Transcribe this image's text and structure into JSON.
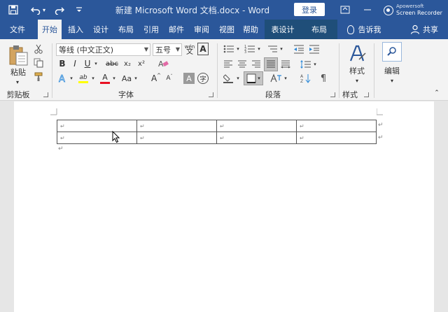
{
  "titlebar": {
    "doc_title": "新建 Microsoft Word 文档.docx  -  Word",
    "login_label": "登录",
    "recorder_line1": "Apowersoft",
    "recorder_line2": "Screen Recorder"
  },
  "tabs": {
    "file": "文件",
    "home": "开始",
    "insert": "插入",
    "design": "设计",
    "layout": "布局",
    "references": "引用",
    "mailings": "邮件",
    "review": "审阅",
    "view": "视图",
    "help": "帮助",
    "table_design": "表设计",
    "table_layout": "布局",
    "tell_me": "告诉我",
    "share": "共享"
  },
  "ribbon": {
    "clipboard": {
      "paste_label": "粘贴",
      "group_label": "剪贴板"
    },
    "font": {
      "font_name": "等线 (中文正文)",
      "font_size": "五号",
      "wen_glyph": "wén",
      "group_label": "字体",
      "bold": "B",
      "italic": "I",
      "underline": "U",
      "strike": "abc",
      "subscript": "x₂",
      "superscript": "x²",
      "change_case": "Aa",
      "grow": "A",
      "shrink": "A",
      "char_shading": "A",
      "enclose": "字",
      "font_color": "A",
      "highlight": "ab",
      "effects": "A",
      "clear_format": "A",
      "char_border": "A"
    },
    "paragraph": {
      "group_label": "段落"
    },
    "styles": {
      "label": "样式",
      "group_label": "样式"
    },
    "editing": {
      "label": "编辑"
    }
  },
  "document": {
    "para_mark": "↵",
    "table_rows": [
      [
        "↵",
        "↵",
        "↵",
        "↵"
      ],
      [
        "↵",
        "↵",
        "↵",
        "↵"
      ]
    ]
  },
  "colors": {
    "brand": "#2b579a",
    "context_tab": "#1f4e79",
    "highlight_yellow": "#ffff00",
    "font_red": "#e81123"
  }
}
